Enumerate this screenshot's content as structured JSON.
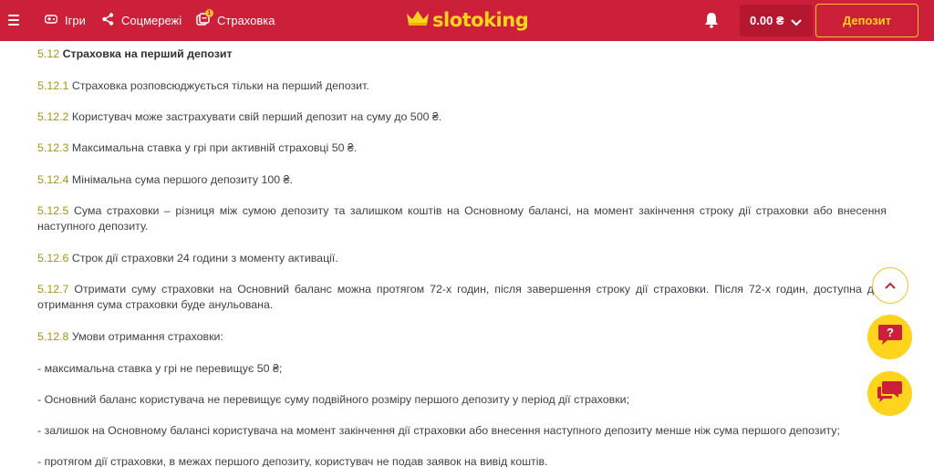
{
  "header": {
    "nav": {
      "games": "Ігри",
      "social": "Соцмережі",
      "insurance": "Страховка",
      "insurance_badge": "1"
    },
    "logo": "slotoking",
    "balance": "0.00 ₴",
    "deposit_label": "Депозит"
  },
  "content": {
    "section_num": "5.12",
    "section_title": "Страховка на перший депозит",
    "items": [
      {
        "num": "5.12.1",
        "text": "Страховка розповсюджується тільки на перший депозит."
      },
      {
        "num": "5.12.2",
        "text": "Користувач може застрахувати свій перший депозит на суму до 500 ₴."
      },
      {
        "num": "5.12.3",
        "text": "Максимальна ставка у грі при активній страховці 50 ₴."
      },
      {
        "num": "5.12.4",
        "text": "Мінімальна сума першого депозиту 100 ₴."
      },
      {
        "num": "5.12.5",
        "text": "Сума страховки – різниця між сумою депозиту та залишком коштів на Основному балансі, на момент закінчення строку дії страховки або внесення наступного депозиту."
      },
      {
        "num": "5.12.6",
        "text": "Строк дії страховки 24 години з моменту активації."
      },
      {
        "num": "5.12.7",
        "text": "Отримати суму страховки на Основний баланс можна протягом 72-х годин, після завершення строку дії страховки. Після 72-х годин, доступна для отримання сума страховки буде анульована."
      },
      {
        "num": "5.12.8",
        "text": "Умови отримання страховки:"
      }
    ],
    "conditions": [
      "- максимальна ставка у грі не перевищує 50 ₴;",
      "- Основний баланс користувача не перевищує суму подвійного розміру першого депозиту у період дії страховки;",
      "- залишок на Основному балансі користувача на момент закінчення дії страховки або внесення наступного депозиту менше ніж сума першого депозиту;",
      "- протягом дії страховки, в межах першого депозиту, користувач не подав заявок на вивід коштів."
    ]
  },
  "colors": {
    "header_bg": "#cc1f3a",
    "accent_yellow": "#ffd41f",
    "number_olive": "#a59419"
  },
  "icons": {
    "menu": "hamburger-icon",
    "games": "game-controller-icon",
    "social": "share-icon",
    "insurance": "insurance-icon",
    "logo_mark": "crown-icon",
    "notifications": "bell-icon",
    "balance_toggle": "chevron-down-icon",
    "scroll_top": "chevron-up-icon",
    "help": "help-chat-icon",
    "chat": "chat-bubble-icon"
  }
}
